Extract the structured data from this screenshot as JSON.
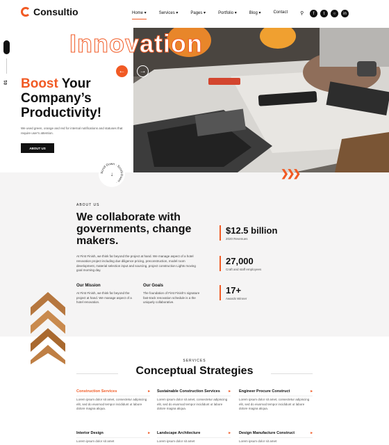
{
  "header": {
    "brand": "Consultio",
    "nav": [
      {
        "label": "Home ▾",
        "active": true
      },
      {
        "label": "Services ▾"
      },
      {
        "label": "Pages ▾"
      },
      {
        "label": "Portfolio ▾"
      },
      {
        "label": "Blog ▾"
      },
      {
        "label": "Contact"
      }
    ],
    "social_icons": [
      "facebook-icon",
      "twitter-icon",
      "instagram-icon",
      "linkedin-icon"
    ]
  },
  "hero": {
    "side_number": "01",
    "overlay_title": "Innovation",
    "heading_accent": "Boost",
    "heading_rest": " Your Company’s Productivity!",
    "description": "We used green, orange and red for internal notifications and statuses that require user's attention.",
    "button_label": "ABOUT US",
    "scroll_label": "Scroll Down · Scroll Down ·"
  },
  "about": {
    "label": "ABOUT US",
    "title": "We collaborate with governments, change makers.",
    "description": "At First Finish, we think far beyond the project at hand. We manage aspect of a hotel renovation project including due diligence pricing, preconstruction, model room development, material selection input and sourcing, project construction Lights moving goal morning day.",
    "mission_title": "Our Mission",
    "mission_text": "At First Finish, we think far beyond the project at hand. We manage aspect of a hotel renovation.",
    "goals_title": "Our Goals",
    "goals_text": "The foundation of First Finish’s signature fast-track renovation schedule is a the uniquely collaborative.",
    "stats": [
      {
        "value": "$12.5 billion",
        "label": "2020 Revenues"
      },
      {
        "value": "27,000",
        "label": "Craft and staff employees"
      },
      {
        "value": "17+",
        "label": "Awards Winner"
      }
    ]
  },
  "services": {
    "label": "SERVICES",
    "title": "Conceptual Strategies",
    "items": [
      {
        "title": "Construction Services",
        "text": "Lorem ipsum dolor sit amet, consectetur adipiscing elit, sed do eiusmod tempor incididunt ut labore dolore magna aliqua."
      },
      {
        "title": "Sustainable Construction Services",
        "text": "Lorem ipsum dolor sit amet, consectetur adipiscing elit, sed do eiusmod tempor incididunt ut labore dolore magna aliqua."
      },
      {
        "title": "Engineer Procure Construct",
        "text": "Lorem ipsum dolor sit amet, consectetur adipiscing elit, sed do eiusmod tempor incididunt ut labore dolore magna aliqua."
      },
      {
        "title": "Interior Design",
        "text": "Lorem ipsum dolor sit amet"
      },
      {
        "title": "Landscape Architecture",
        "text": "Lorem ipsum dolor sit amet"
      },
      {
        "title": "Design Manufacture Construct",
        "text": "Lorem ipsum dolor sit amet"
      }
    ]
  },
  "colors": {
    "accent": "#f15a24",
    "dark": "#111111",
    "section_bg": "#f5f4f4"
  }
}
